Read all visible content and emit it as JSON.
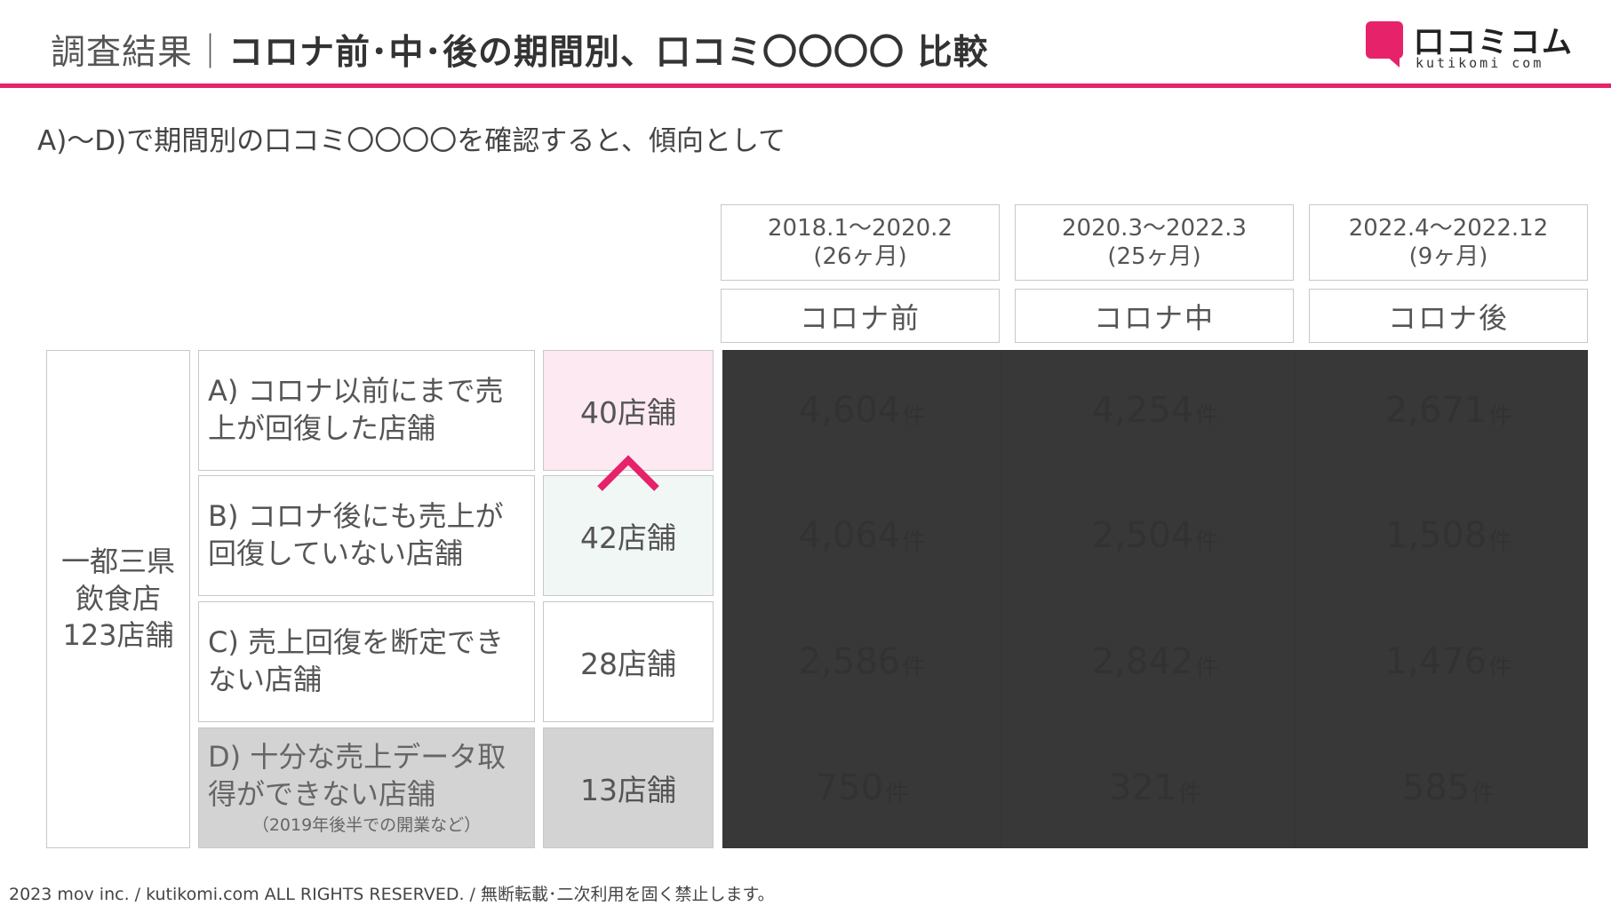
{
  "header": {
    "title_prefix": "調査結果｜",
    "title_main": "コロナ前･中･後の期間別、口コミ〇〇〇〇 比較",
    "accent_color": "#e6226a"
  },
  "logo": {
    "name": "口コミコム",
    "sub": "kutikomi com"
  },
  "subtitle": "A)〜D)で期間別の口コミ〇〇〇〇を確認すると、傾向として",
  "periods": [
    {
      "range": "2018.1〜2020.2",
      "months": "(26ヶ月)",
      "phase": "コロナ前"
    },
    {
      "range": "2020.3〜2022.3",
      "months": "(25ヶ月)",
      "phase": "コロナ中"
    },
    {
      "range": "2022.4〜2022.12",
      "months": "(9ヶ月)",
      "phase": "コロナ後"
    }
  ],
  "region": {
    "line1": "一都三県",
    "line2": "飲食店",
    "line3": "123店舗"
  },
  "categories": [
    {
      "label": "A) コロナ以前にまで売上が回復した店舗",
      "note": "",
      "count": "40店舗",
      "values": [
        "4,604",
        "4,254",
        "2,671"
      ]
    },
    {
      "label": "B) コロナ後にも売上が回復していない店舗",
      "note": "",
      "count": "42店舗",
      "values": [
        "4,064",
        "2,504",
        "1,508"
      ]
    },
    {
      "label": "C) 売上回復を断定できない店舗",
      "note": "",
      "count": "28店舗",
      "values": [
        "2,586",
        "2,842",
        "1,476"
      ]
    },
    {
      "label": "D) 十分な売上データ取得ができない店舗",
      "note": "（2019年後半での開業など）",
      "count": "13店舗",
      "values": [
        "750",
        "321",
        "585"
      ]
    }
  ],
  "unit": "件",
  "footer": "2023 mov inc. / kutikomi.com ALL RIGHTS RESERVED. / 無断転載･二次利用を固く禁止します。"
}
